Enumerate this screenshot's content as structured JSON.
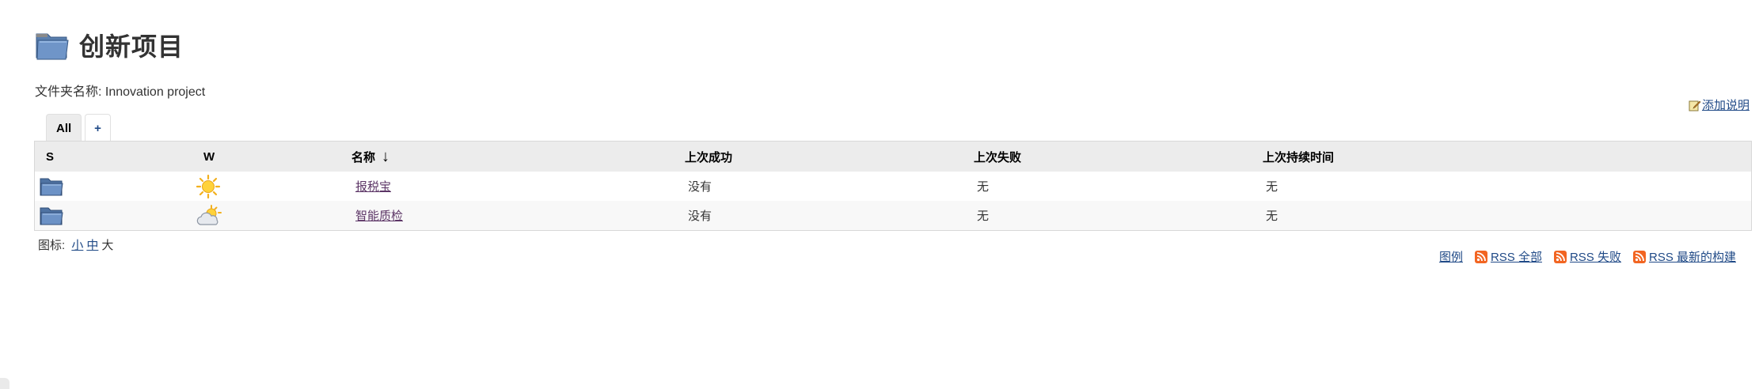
{
  "page": {
    "title": "创新项目",
    "folder_name_label": "文件夹名称: Innovation project",
    "add_description": "添加说明"
  },
  "tabs": [
    {
      "label": "All",
      "active": true
    },
    {
      "label": "+",
      "active": false
    }
  ],
  "table": {
    "headers": {
      "s": "S",
      "w": "W",
      "name": "名称",
      "sort_indicator": "↓",
      "last_success": "上次成功",
      "last_failure": "上次失败",
      "last_duration": "上次持续时间"
    },
    "rows": [
      {
        "status_icon": "folder-icon",
        "weather_icon": "sunny-icon",
        "name": "报税宝",
        "last_success": "没有",
        "last_failure": "无",
        "last_duration": "无"
      },
      {
        "status_icon": "folder-icon",
        "weather_icon": "partly-cloudy-icon",
        "name": "智能质检",
        "last_success": "没有",
        "last_failure": "无",
        "last_duration": "无"
      }
    ]
  },
  "icon_size": {
    "label": "图标:",
    "options": [
      "小",
      "中",
      "大"
    ],
    "current": "大"
  },
  "footer": {
    "legend": "图例",
    "rss_all": "RSS 全部",
    "rss_failures": "RSS 失败",
    "rss_latest": "RSS 最新的构建"
  },
  "colors": {
    "link": "#204a87",
    "visited_link": "#5c3566",
    "header_bg": "#ececec",
    "rss_orange": "#f26522"
  }
}
